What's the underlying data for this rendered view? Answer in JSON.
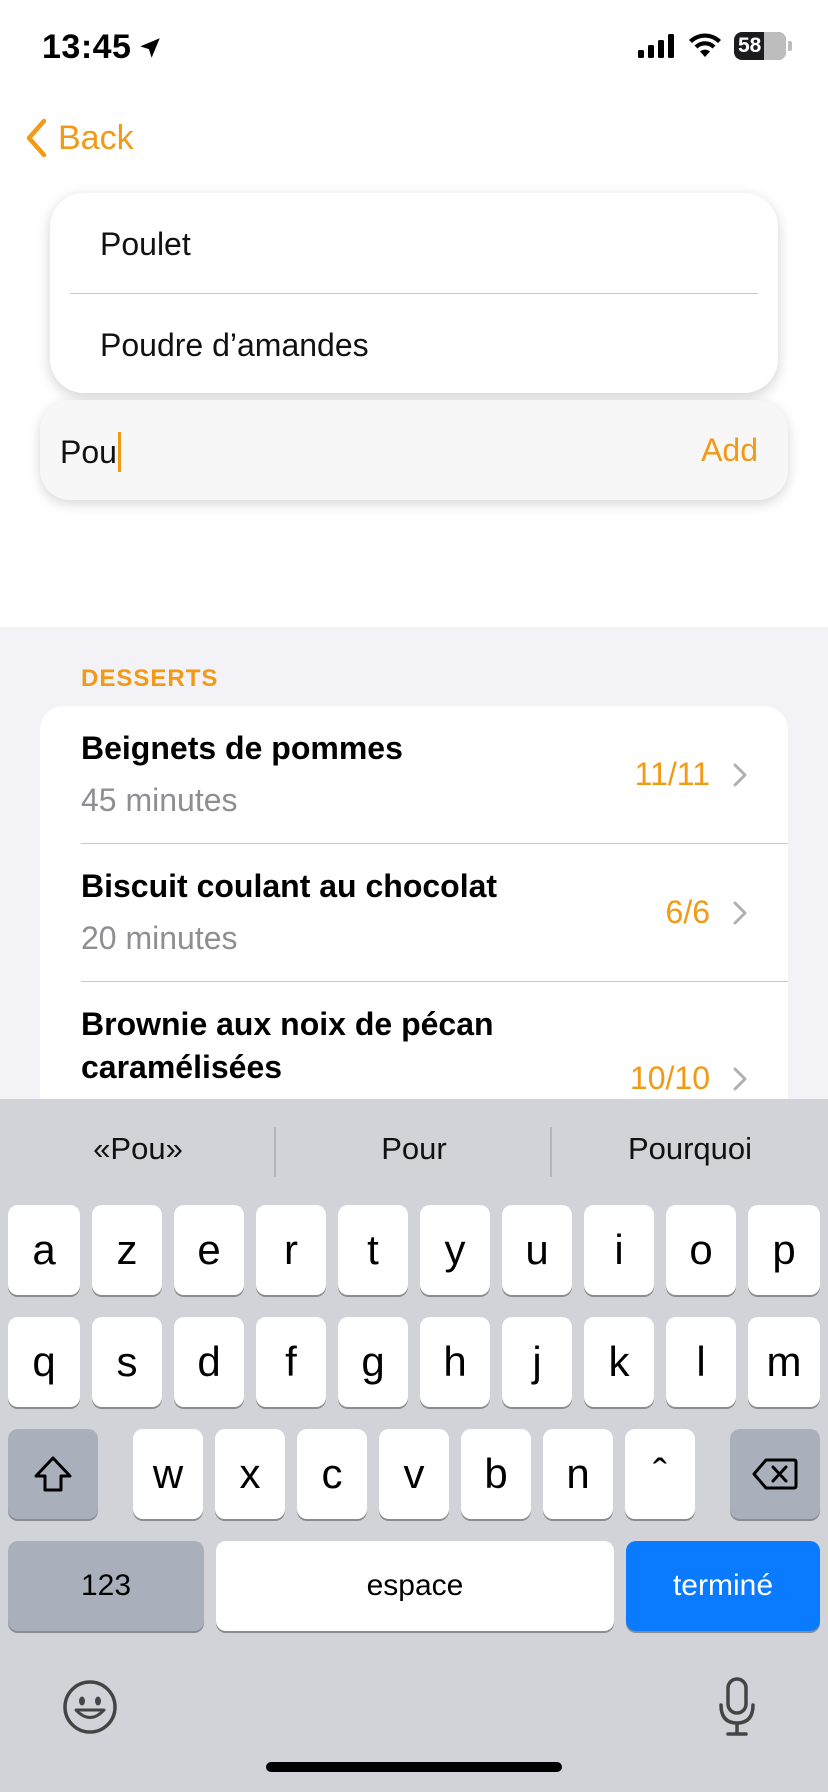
{
  "status": {
    "time": "13:45",
    "battery": "58"
  },
  "nav": {
    "back_label": "Back"
  },
  "suggestions": [
    "Poulet",
    "Poudre d’amandes"
  ],
  "input": {
    "value": "Pou",
    "add_label": "Add"
  },
  "section": {
    "title": "DESSERTS"
  },
  "recipes": [
    {
      "title": "Beignets de pommes",
      "subtitle": "45 minutes",
      "count": "11/11"
    },
    {
      "title": "Biscuit coulant au chocolat",
      "subtitle": "20 minutes",
      "count": "6/6"
    },
    {
      "title_line1": "Brownie aux noix de pécan",
      "title_line2": "caramélisées",
      "count": "10/10"
    }
  ],
  "keyboard": {
    "predictions": [
      "«Pou»",
      "Pour",
      "Pourquoi"
    ],
    "row1": [
      "a",
      "z",
      "e",
      "r",
      "t",
      "y",
      "u",
      "i",
      "o",
      "p"
    ],
    "row2": [
      "q",
      "s",
      "d",
      "f",
      "g",
      "h",
      "j",
      "k",
      "l",
      "m"
    ],
    "row3": [
      "w",
      "x",
      "c",
      "v",
      "b",
      "n",
      "ˆ"
    ],
    "numbers_label": "123",
    "space_label": "espace",
    "done_label": "terminé"
  },
  "colors": {
    "accent": "#F29A16",
    "done_key": "#0A7AFF",
    "list_background": "#F2F2F7",
    "keyboard_background": "#D1D3D9"
  }
}
